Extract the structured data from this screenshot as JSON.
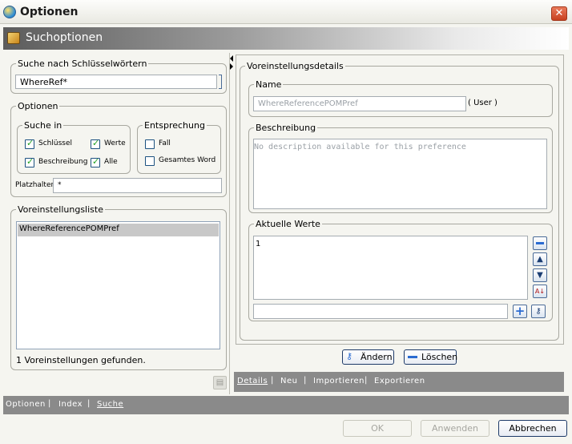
{
  "window": {
    "title": "Optionen"
  },
  "header": {
    "title": "Suchoptionen"
  },
  "search": {
    "legend": "Suche nach Schlüsselwörtern",
    "value": "WhereRef*"
  },
  "options": {
    "legend": "Optionen",
    "suche_in": {
      "legend": "Suche in",
      "schluessel": "Schlüssel",
      "werte": "Werte",
      "beschreibung": "Beschreibung",
      "alle": "Alle"
    },
    "entsprechung": {
      "legend": "Entsprechung",
      "fall": "Fall",
      "gesamtes_word": "Gesamtes Word"
    },
    "platzhalter_label": "Platzhalter",
    "platzhalter_value": "*"
  },
  "pref_list": {
    "legend": "Voreinstellungsliste",
    "items": [
      "WhereReferencePOMPref"
    ],
    "found_text": "1 Voreinstellungen gefunden."
  },
  "details": {
    "legend": "Voreinstellungsdetails",
    "name_legend": "Name",
    "name_value": "WhereReferencePOMPref",
    "scope": "( User )",
    "desc_legend": "Beschreibung",
    "desc_value": "No description available for this preference",
    "values_legend": "Aktuelle Werte",
    "values": [
      "1"
    ]
  },
  "actions": {
    "aendern": "Ändern",
    "loeschen": "Löschen"
  },
  "right_tabs": [
    "Details",
    "Neu",
    "Importieren",
    "Exportieren"
  ],
  "left_tabs": [
    "Optionen",
    "Index",
    "Suche"
  ],
  "footer": {
    "ok": "OK",
    "anwenden": "Anwenden",
    "abbrechen": "Abbrechen"
  }
}
